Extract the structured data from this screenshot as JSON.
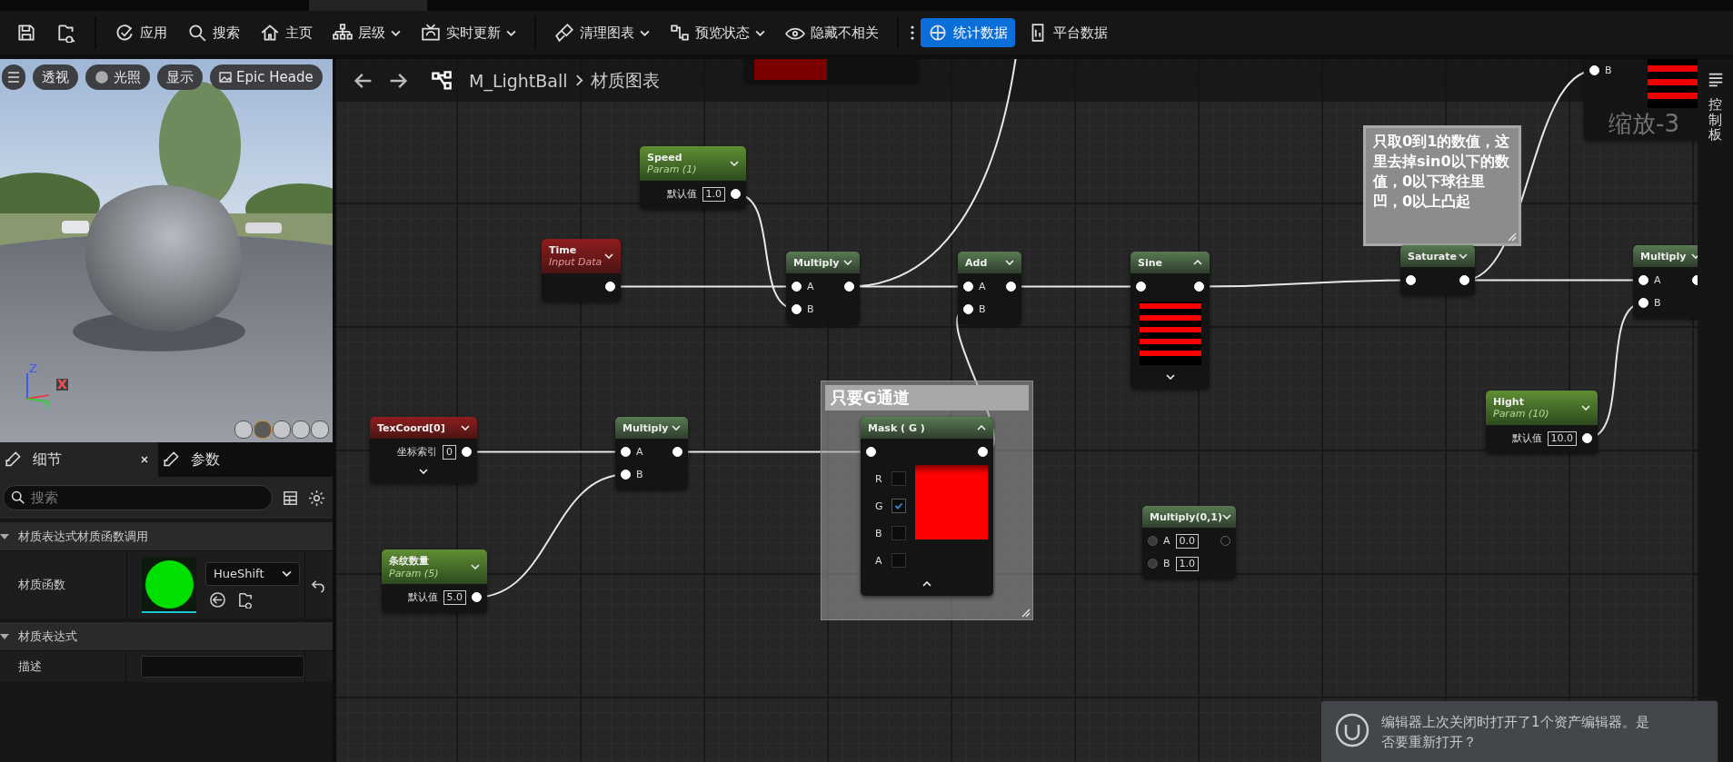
{
  "toolbar": {
    "buttons": [
      {
        "label": "应用",
        "dropdown": false,
        "selected": false
      },
      {
        "label": "搜索",
        "dropdown": false,
        "selected": false
      },
      {
        "label": "主页",
        "dropdown": false,
        "selected": false
      },
      {
        "label": "层级",
        "dropdown": true,
        "selected": false
      },
      {
        "label": "实时更新",
        "dropdown": true,
        "selected": false
      },
      {
        "label": "清理图表",
        "dropdown": true,
        "selected": false
      },
      {
        "label": "预览状态",
        "dropdown": true,
        "selected": false
      },
      {
        "label": "隐藏不相关",
        "dropdown": false,
        "selected": false
      },
      {
        "label": "统计数据",
        "dropdown": false,
        "selected": true
      },
      {
        "label": "平台数据",
        "dropdown": false,
        "selected": false
      }
    ]
  },
  "viewport": {
    "buttons": [
      "透视",
      "光照",
      "显示",
      "Epic Heade"
    ],
    "axes": [
      "Z",
      "X",
      "Y"
    ]
  },
  "details_panel": {
    "tabs": [
      {
        "label": "细节",
        "selected": true,
        "closable": true
      },
      {
        "label": "参数",
        "selected": false,
        "closable": false
      }
    ],
    "search": {
      "placeholder": "搜索"
    },
    "sections": [
      {
        "title": "材质表达式材质函数调用",
        "expanded": true,
        "rows": [
          {
            "label": "材质函数",
            "kind": "function",
            "value": "HueShift"
          }
        ]
      },
      {
        "title": "材质表达式",
        "expanded": true,
        "rows": [
          {
            "label": "描述",
            "kind": "text"
          }
        ]
      }
    ]
  },
  "graph": {
    "breadcrumb": [
      "M_LightBall",
      "材质图表"
    ],
    "zoom_label": "缩放-3",
    "side_tab": "控制板",
    "comments": [
      {
        "kind": "group",
        "text": "只要G通道"
      },
      {
        "kind": "note",
        "text": "只取0到1的数值，这里去掉sin0以下的数值，0以下球往里凹，0以上凸起"
      }
    ],
    "nodes": [
      {
        "kind": "swatch"
      },
      {
        "kind": "stub",
        "pins": [
          {
            "label": "B",
            "connected": true
          }
        ]
      },
      {
        "kind": "param",
        "title": "Speed",
        "subtitle": "Param (1)",
        "field": "默认值",
        "value": "1.0",
        "expanded": false,
        "output_connected": true
      },
      {
        "kind": "input",
        "title": "Time",
        "subtitle": "Input Data",
        "expanded": false,
        "output_connected": true
      },
      {
        "kind": "math",
        "title": "Multiply",
        "pins": [
          {
            "label": "A",
            "connected": true
          },
          {
            "label": "B",
            "connected": true
          }
        ],
        "expanded": false,
        "output_connected": true
      },
      {
        "kind": "math",
        "title": "Add",
        "pins": [
          {
            "label": "A",
            "connected": true
          },
          {
            "label": "B",
            "connected": true
          }
        ],
        "expanded": false,
        "output_connected": true
      },
      {
        "kind": "preview",
        "title": "Sine",
        "expanded": true,
        "advanced_expanded": false,
        "output_connected": true
      },
      {
        "kind": "unary",
        "title": "Saturate",
        "expanded": false,
        "output_connected": true
      },
      {
        "kind": "math",
        "title": "Multiply",
        "pins": [
          {
            "label": "A",
            "connected": true
          },
          {
            "label": "B",
            "connected": true
          }
        ],
        "expanded": false,
        "output_connected": true
      },
      {
        "kind": "param",
        "title": "Hight",
        "subtitle": "Param (10)",
        "field": "默认值",
        "value": "10.0",
        "expanded": false,
        "output_connected": true
      },
      {
        "kind": "input",
        "title": "TexCoord[0]",
        "field": "坐标索引",
        "value": "0",
        "expanded": false,
        "advanced_expanded": false,
        "output_connected": true
      },
      {
        "kind": "math",
        "title": "Multiply",
        "pins": [
          {
            "label": "A",
            "connected": true
          },
          {
            "label": "B",
            "connected": true
          }
        ],
        "expanded": false,
        "output_connected": true
      },
      {
        "kind": "mask",
        "title": "Mask ( G )",
        "expanded": true,
        "advanced_expanded": true,
        "output_connected": true,
        "channels": [
          {
            "label": "R",
            "checked": false
          },
          {
            "label": "G",
            "checked": true
          },
          {
            "label": "B",
            "checked": false
          },
          {
            "label": "A",
            "checked": false
          }
        ]
      },
      {
        "kind": "math",
        "title": "Multiply(0,1)",
        "pins": [
          {
            "label": "A",
            "connected": false,
            "value": "0.0"
          },
          {
            "label": "B",
            "connected": false,
            "value": "1.0"
          }
        ],
        "expanded": false,
        "output_connected": false
      },
      {
        "kind": "param",
        "title": "条纹数量",
        "subtitle": "Param (5)",
        "field": "默认值",
        "value": "5.0",
        "expanded": false,
        "output_connected": true
      }
    ]
  },
  "notification": {
    "text": "编辑器上次关闭时打开了1个资产编辑器。是否要重新打开？"
  }
}
